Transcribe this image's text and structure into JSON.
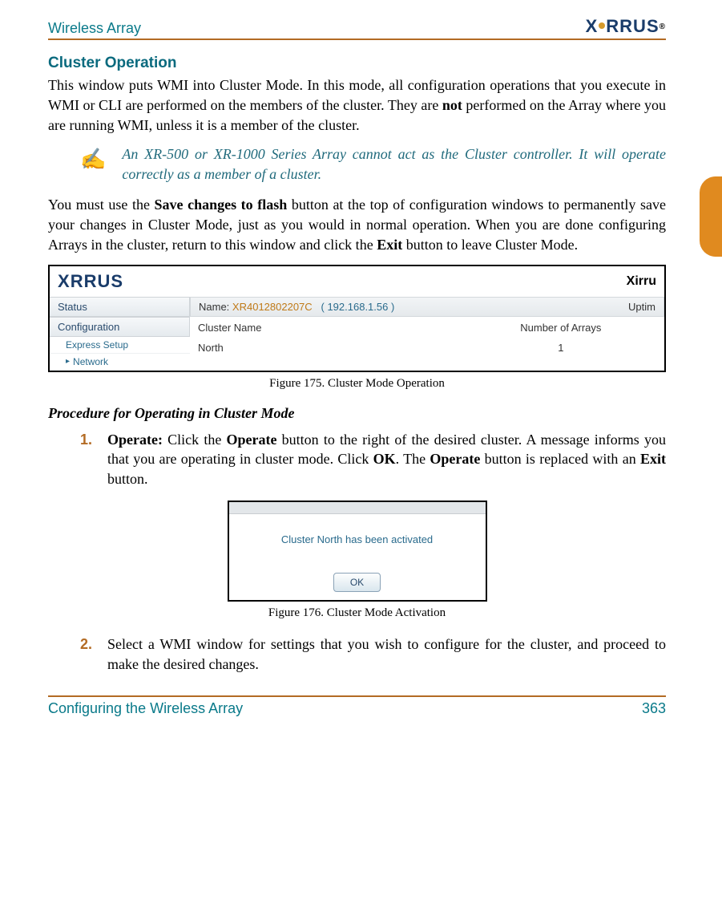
{
  "header": {
    "left": "Wireless Array",
    "logo": {
      "x": "X",
      "rest": "RRUS",
      "reg": "®"
    }
  },
  "side_tab": "",
  "section_title": "Cluster Operation",
  "para1_a": "This window puts WMI into Cluster Mode. In this mode, all configuration operations that you execute in WMI or CLI are performed on the members of the cluster. They are ",
  "para1_bold": "not",
  "para1_b": " performed on the Array where you are running WMI, unless it is a member of the cluster.",
  "note": "An XR-500 or XR-1000 Series Array cannot act as the Cluster controller. It will operate correctly as a member of a cluster.",
  "para2_a": "You must use the ",
  "para2_bold1": "Save changes to flash",
  "para2_b": " button at the top of configuration windows to permanently save your changes in Cluster Mode, just as you would in normal operation. When you are done configuring Arrays in the cluster, return to this window and click the ",
  "para2_bold2": "Exit",
  "para2_c": " button to leave Cluster Mode.",
  "fig175": {
    "sidebar": {
      "status": "Status",
      "configuration": "Configuration",
      "express": "Express Setup",
      "network": "Network"
    },
    "name_label": "Name:",
    "device": "XR4012802207C",
    "ip": "( 192.168.1.56 )",
    "uptime": "Uptim",
    "xirr_right": "Xirru",
    "col_cluster": "Cluster Name",
    "col_num": "Number of Arrays",
    "row_cluster": "North",
    "row_num": "1",
    "caption": "Figure 175. Cluster Mode Operation"
  },
  "proc_heading": "Procedure for Operating in Cluster Mode",
  "step1": {
    "num": "1.",
    "bold_lead": "Operate:",
    "t1": " Click the ",
    "b1": "Operate",
    "t2": " button to the right of the desired cluster. A message informs you that you are operating in cluster mode. Click ",
    "b2": "OK",
    "t3": ". The ",
    "b3": "Operate",
    "t4": " button is replaced with an ",
    "b4": "Exit",
    "t5": " button."
  },
  "fig176": {
    "message": "Cluster North has been activated",
    "ok": "OK",
    "caption": "Figure 176. Cluster Mode Activation"
  },
  "step2": {
    "num": "2.",
    "text": "Select a WMI window for settings that you wish to configure for the cluster, and proceed to make the desired changes."
  },
  "footer": {
    "left": "Configuring the Wireless Array",
    "right": "363"
  }
}
